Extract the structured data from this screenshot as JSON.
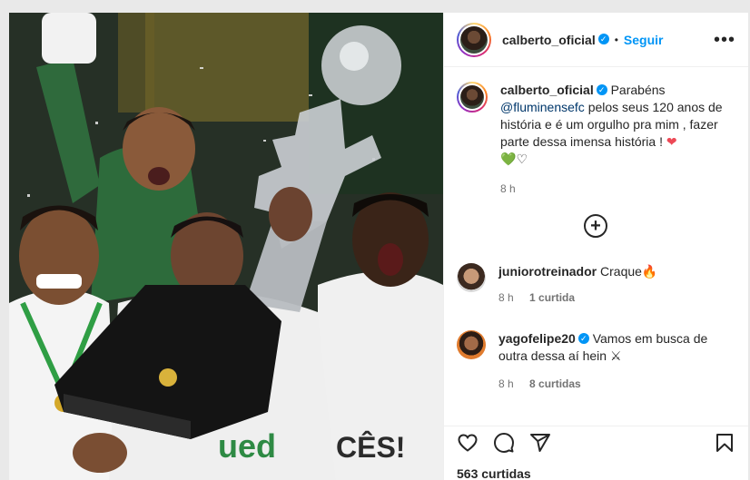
{
  "post": {
    "author": "calberto_oficial",
    "follow_label": "Seguir",
    "more_label": "•••",
    "dot": "•",
    "caption": {
      "username": "calberto_oficial",
      "text_before": " Parabéns ",
      "mention": "@fluminensefc",
      "text_after": " pelos seus 120 anos de história e é um orgulho pra mim , fazer parte dessa imensa história ! ",
      "emoji_red_heart": "❤",
      "emoji_green_heart": "💚",
      "emoji_white_heart": "♡",
      "time": "8 h"
    },
    "comments": [
      {
        "username": "juniorotreinador",
        "verified": false,
        "text": "Craque🔥",
        "time": "8 h",
        "likes": "1 curtida"
      },
      {
        "username": "yagofelipe20",
        "verified": true,
        "text": "Vamos em busca de outra dessa aí hein ⚔",
        "time": "8 h",
        "likes": "8 curtidas"
      }
    ],
    "likes_count": "563 curtidas",
    "photo_texts": {
      "shirt_text": "CÊS!",
      "sponsor": "ued"
    }
  }
}
